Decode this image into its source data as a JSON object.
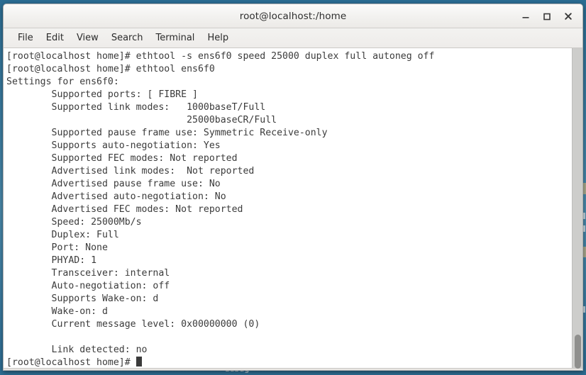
{
  "desktop": {
    "icon_label_partial": "debug"
  },
  "window": {
    "title": "root@localhost:/home",
    "buttons": {
      "minimize": "minimize-button",
      "maximize": "maximize-button",
      "close": "close-button"
    }
  },
  "menubar": {
    "items": [
      {
        "label": "File"
      },
      {
        "label": "Edit"
      },
      {
        "label": "View"
      },
      {
        "label": "Search"
      },
      {
        "label": "Terminal"
      },
      {
        "label": "Help"
      }
    ]
  },
  "terminal": {
    "prompt": "[root@localhost home]#",
    "foreground_color": "#3b3b3b",
    "background_color": "#ffffff",
    "lines": [
      "[root@localhost home]# ethtool -s ens6f0 speed 25000 duplex full autoneg off",
      "[root@localhost home]# ethtool ens6f0",
      "Settings for ens6f0:",
      "        Supported ports: [ FIBRE ]",
      "        Supported link modes:   1000baseT/Full",
      "                                25000baseCR/Full",
      "        Supported pause frame use: Symmetric Receive-only",
      "        Supports auto-negotiation: Yes",
      "        Supported FEC modes: Not reported",
      "        Advertised link modes:  Not reported",
      "        Advertised pause frame use: No",
      "        Advertised auto-negotiation: No",
      "        Advertised FEC modes: Not reported",
      "        Speed: 25000Mb/s",
      "        Duplex: Full",
      "        Port: None",
      "        PHYAD: 1",
      "        Transceiver: internal",
      "        Auto-negotiation: off",
      "        Supports Wake-on: d",
      "        Wake-on: d",
      "        Current message level: 0x00000000 (0)",
      "",
      "        Link detected: no"
    ],
    "last_prompt": "[root@localhost home]# ",
    "cursor": "block"
  },
  "scrollbar": {
    "thumb_position": "bottom"
  }
}
